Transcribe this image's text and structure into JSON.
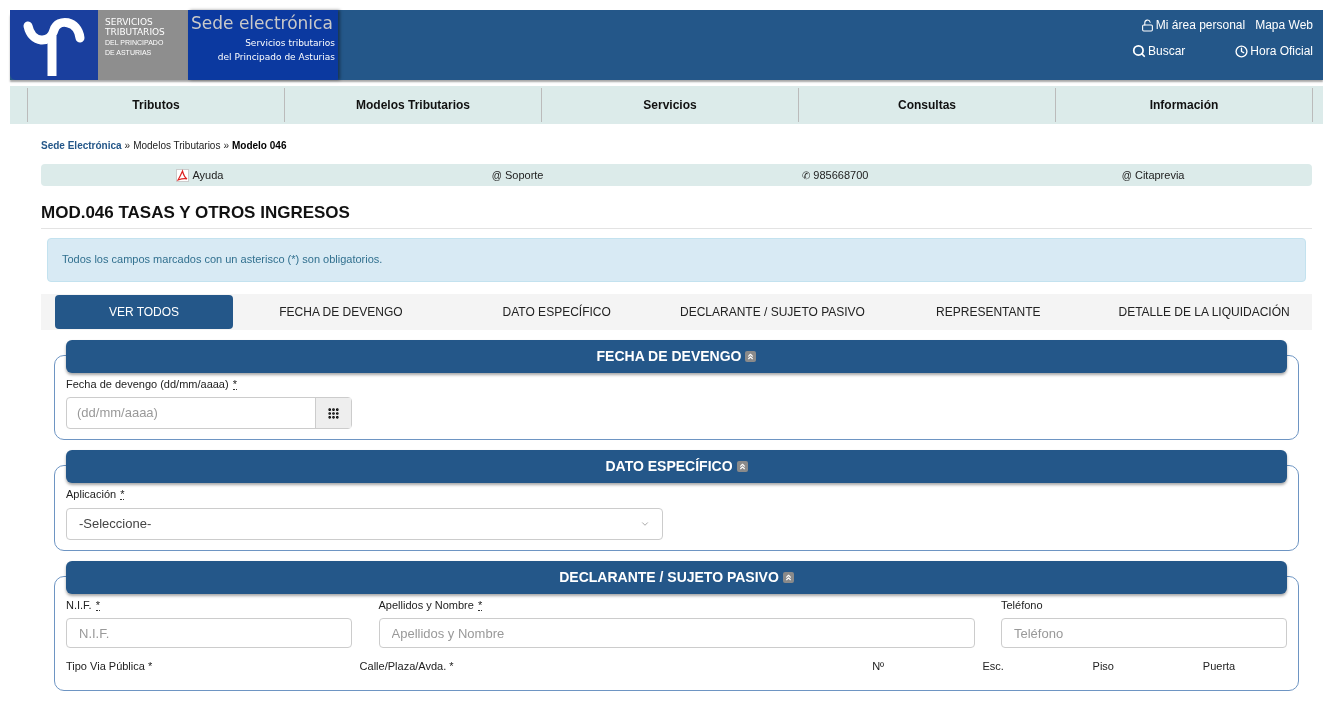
{
  "header": {
    "logo_lines": [
      "SERVICIOS",
      "TRIBUTARIOS"
    ],
    "logo_small": [
      "DEL PRINCIPADO",
      "DE ASTURIAS"
    ],
    "site_title": "Sede electrónica",
    "site_subtitle": [
      "Servicios tributarios",
      "del Principado de Asturias"
    ],
    "links": [
      "Mi área personal",
      "Mapa Web"
    ],
    "tools": [
      "Buscar",
      "Hora Oficial"
    ]
  },
  "nav": [
    "Tributos",
    "Modelos Tributarios",
    "Servicios",
    "Consultas",
    "Información"
  ],
  "breadcrumb": [
    {
      "label": "Sede Electrónica",
      "kind": "link"
    },
    {
      "label": "»",
      "kind": "sep"
    },
    {
      "label": "Modelos Tributarios",
      "kind": "plain"
    },
    {
      "label": "»",
      "kind": "sep"
    },
    {
      "label": "Modelo 046",
      "kind": "current"
    }
  ],
  "help_bar": [
    {
      "label": "Ayuda"
    },
    {
      "label": "Soporte",
      "prefix": "@"
    },
    {
      "label": "985668700",
      "prefix": "✆"
    },
    {
      "label": "Citaprevia",
      "prefix": "@"
    }
  ],
  "page_title": "MOD.046 TASAS Y OTROS INGRESOS",
  "notice": "Todos los campos marcados con un asterisco (*) son obligatorios.",
  "tabs": [
    {
      "label": "VER TODOS",
      "selected": true
    },
    {
      "label": "FECHA DE DEVENGO",
      "selected": false
    },
    {
      "label": "DATO ESPECÍFICO",
      "selected": false
    },
    {
      "label": "DECLARANTE / SUJETO PASIVO",
      "selected": false
    },
    {
      "label": "REPRESENTANTE",
      "selected": false
    },
    {
      "label": "DETALLE DE LA LIQUIDACIÓN",
      "selected": false
    }
  ],
  "sections": [
    {
      "title": "FECHA DE DEVENGO",
      "rows": [
        [
          {
            "kind": "date",
            "label": "Fecha de devengo (dd/mm/aaaa)",
            "mark": "*",
            "placeholder": "(dd/mm/aaaa)"
          }
        ]
      ]
    },
    {
      "title": "DATO ESPECÍFICO",
      "rows": [
        [
          {
            "kind": "select",
            "label": "Aplicación",
            "mark": "*",
            "value": "-Seleccione-"
          }
        ]
      ]
    },
    {
      "title": "DECLARANTE / SUJETO PASIVO",
      "rows": [
        [
          {
            "kind": "text",
            "label": "N.I.F.",
            "mark": "*",
            "placeholder": "N.I.F."
          },
          {
            "kind": "text",
            "label": "Apellidos y Nombre",
            "mark": "*",
            "placeholder": "Apellidos y Nombre"
          },
          {
            "kind": "text",
            "label": "Teléfono",
            "placeholder": "Teléfono"
          }
        ],
        [
          {
            "kind": "label",
            "label": "Tipo Via Pública *"
          },
          {
            "kind": "label",
            "label": "Calle/Plaza/Avda. *"
          },
          {
            "kind": "label",
            "label": "Nº"
          },
          {
            "kind": "label",
            "label": "Esc."
          },
          {
            "kind": "label",
            "label": "Piso"
          },
          {
            "kind": "label",
            "label": "Puerta"
          }
        ]
      ]
    }
  ]
}
